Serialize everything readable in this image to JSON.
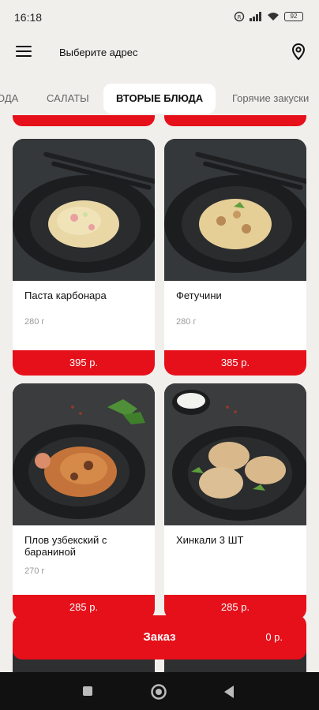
{
  "status": {
    "time": "16:18",
    "battery": "92"
  },
  "header": {
    "address_prompt": "Выберите адрес"
  },
  "tabs": [
    {
      "label": "ОДА"
    },
    {
      "label": "САЛАТЫ"
    },
    {
      "label": "ВТОРЫЕ  БЛЮДА"
    },
    {
      "label": "Горячие закуски"
    }
  ],
  "products": [
    {
      "name": "Паста карбонара",
      "weight": "280 г",
      "price": "395 р."
    },
    {
      "name": "Фетучини",
      "weight": "280 г",
      "price": "385 р."
    },
    {
      "name": "Плов узбекский с бараниной",
      "weight": "270 г",
      "price": "285 р."
    },
    {
      "name": "Хинкали 3 ШТ",
      "weight": "",
      "price": "285 р."
    }
  ],
  "order": {
    "label": "Заказ",
    "sum": "0 р."
  },
  "colors": {
    "accent": "#e5101a",
    "background": "#f1efec"
  }
}
